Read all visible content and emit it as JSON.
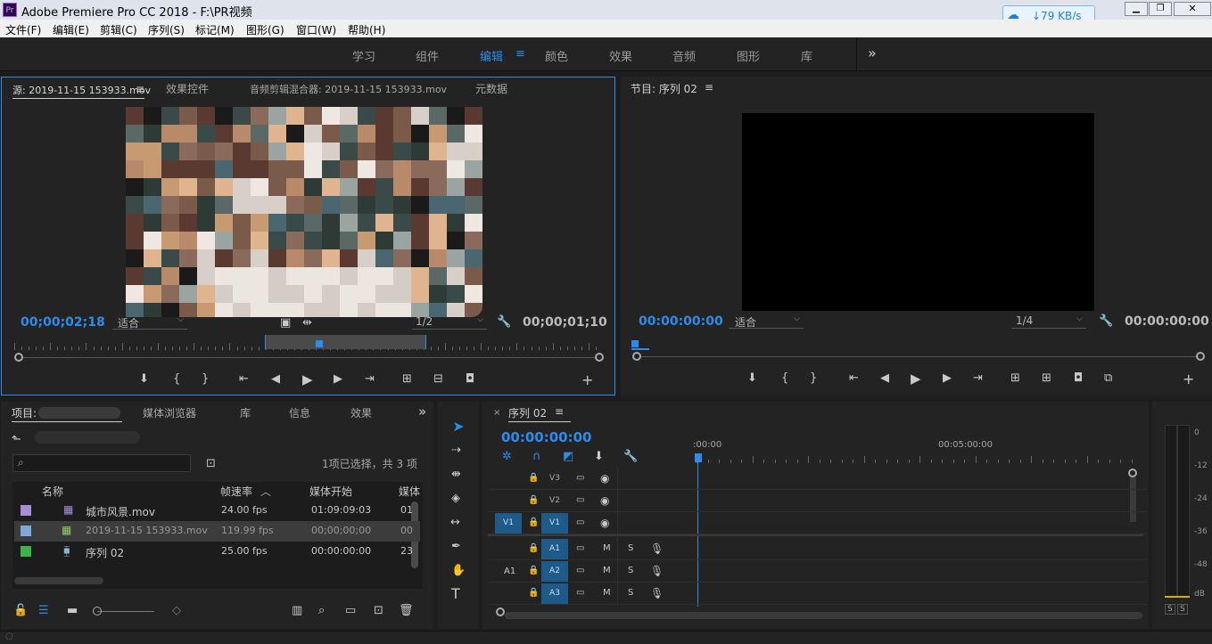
{
  "app": {
    "title": "Adobe Premiere Pro CC 2018 - F:\\PR视频",
    "logo": "Pr",
    "net_speed": "↓79 KB/s",
    "net_icon": "cloud-icon"
  },
  "menu": [
    "文件(F)",
    "编辑(E)",
    "剪辑(C)",
    "序列(S)",
    "标记(M)",
    "图形(G)",
    "窗口(W)",
    "帮助(H)"
  ],
  "workspaces": [
    "学习",
    "组件",
    "编辑",
    "颜色",
    "效果",
    "音频",
    "图形",
    "库"
  ],
  "active_workspace": "编辑",
  "more_glyph": "»",
  "source": {
    "tabs": [
      "源: 2019-11-15 153933.mov",
      "效果控件",
      "音频剪辑混合器: 2019-11-15 153933.mov",
      "元数据"
    ],
    "timecode_left": "00;00;02;18",
    "fit": "适合",
    "res": "1/2",
    "timecode_right": "00;00;01;10"
  },
  "program": {
    "tab": "节目: 序列 02",
    "timecode_left": "00:00:00:00",
    "fit": "适合",
    "res": "1/4",
    "timecode_right": "00:00:00:00"
  },
  "project": {
    "tabs": [
      "项目:",
      "媒体浏览器",
      "库",
      "信息",
      "效果"
    ],
    "selection": "1项已选择，共 3 项",
    "columns": [
      "名称",
      "帧速率",
      "媒体开始",
      "媒体"
    ],
    "rows": [
      {
        "name": "城市风景.mov",
        "fps": "24.00 fps",
        "start": "01:09:09:03",
        "extra": "01",
        "color": "#a58fd8"
      },
      {
        "name": "2019-11-15 153933.mov",
        "fps": "119.99 fps",
        "start": "00;00;00;00",
        "extra": "00",
        "color": "#7fa8d8"
      },
      {
        "name": "序列 02",
        "fps": "25.00 fps",
        "start": "00:00:00:00",
        "extra": "23",
        "color": "#3db34a"
      }
    ]
  },
  "timeline": {
    "tab": "序列 02",
    "timecode": "00:00:00:00",
    "ruler": [
      ":00:00",
      "00:05:00:00"
    ],
    "tracks": [
      {
        "name": "V3",
        "src": "",
        "type": "video"
      },
      {
        "name": "V2",
        "src": "",
        "type": "video"
      },
      {
        "name": "V1",
        "src": "V1",
        "type": "video"
      },
      {
        "name": "A1",
        "src": "",
        "type": "audio"
      },
      {
        "name": "A2",
        "src": "A1",
        "type": "audio"
      },
      {
        "name": "A3",
        "src": "",
        "type": "audio"
      }
    ],
    "m": "M",
    "s": "S"
  },
  "meter": {
    "marks": [
      "0",
      "-12",
      "-24",
      "-36",
      "-48",
      "dB"
    ],
    "solo": [
      "S",
      "S"
    ]
  }
}
